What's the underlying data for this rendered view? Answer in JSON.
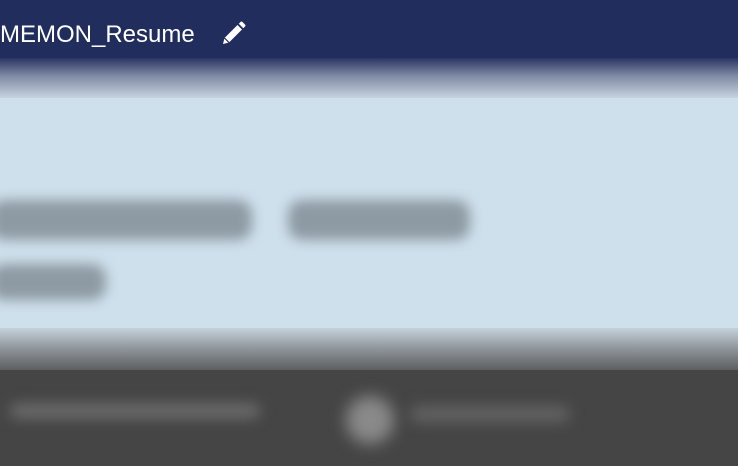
{
  "header": {
    "document_title": "MEMON_Resume",
    "edit_icon": "pencil-icon"
  },
  "colors": {
    "header_background": "#212d5c",
    "content_background": "#cee0ec",
    "footer_background": "#454545"
  }
}
